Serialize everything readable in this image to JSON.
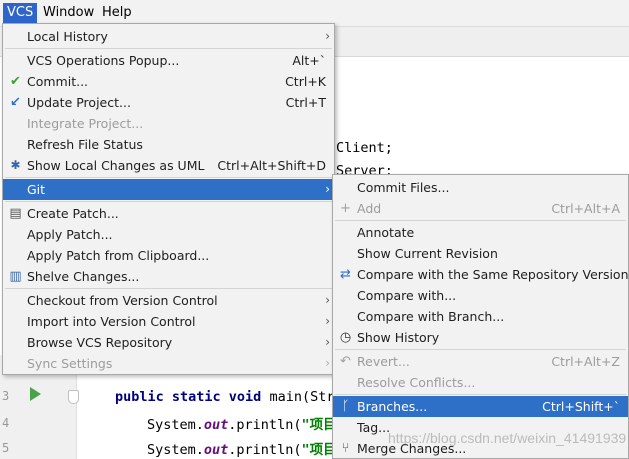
{
  "menubar": {
    "vcs": "VCS",
    "window": "Window",
    "help": "Help"
  },
  "editor": {
    "code_line_client": "Client;",
    "code_line_server": "Server;",
    "main_sig_kw": "public static void",
    "main_sig_rest": " main(Str",
    "println1_pre": "System.",
    "println1_out": "out",
    "println1_post": ".println(",
    "println1_str": "\"项目",
    "println2_pre": "System.",
    "println2_out": "out",
    "println2_post": ".println(",
    "println2_str": "\"项目",
    "line_numbers": [
      "3",
      "4",
      "5"
    ]
  },
  "vcs_menu": {
    "items": [
      {
        "label": "Local History",
        "shortcut": "",
        "submenu": true
      },
      {
        "label": "VCS Operations Popup...",
        "shortcut": "Alt+`"
      },
      {
        "label": "Commit...",
        "shortcut": "Ctrl+K",
        "icon": "check-icon"
      },
      {
        "label": "Update Project...",
        "shortcut": "Ctrl+T",
        "icon": "update-arrow-icon"
      },
      {
        "label": "Integrate Project...",
        "shortcut": "",
        "disabled": true
      },
      {
        "label": "Refresh File Status",
        "shortcut": ""
      },
      {
        "label": "Show Local Changes as UML",
        "shortcut": "Ctrl+Alt+Shift+D",
        "icon": "uml-icon"
      },
      {
        "label": "Git",
        "shortcut": "",
        "submenu": true,
        "selected": true
      },
      {
        "label": "Create Patch...",
        "shortcut": "",
        "icon": "patch-icon"
      },
      {
        "label": "Apply Patch...",
        "shortcut": ""
      },
      {
        "label": "Apply Patch from Clipboard...",
        "shortcut": ""
      },
      {
        "label": "Shelve Changes...",
        "shortcut": "",
        "icon": "shelve-icon"
      },
      {
        "label": "Checkout from Version Control",
        "shortcut": "",
        "submenu": true
      },
      {
        "label": "Import into Version Control",
        "shortcut": "",
        "submenu": true
      },
      {
        "label": "Browse VCS Repository",
        "shortcut": "",
        "submenu": true
      },
      {
        "label": "Sync Settings",
        "shortcut": "",
        "submenu": true,
        "disabled": true
      }
    ]
  },
  "git_menu": {
    "items": [
      {
        "label": "Commit Files...",
        "shortcut": ""
      },
      {
        "label": "Add",
        "shortcut": "Ctrl+Alt+A",
        "disabled": true,
        "icon": "plus-icon"
      },
      {
        "label": "Annotate",
        "shortcut": ""
      },
      {
        "label": "Show Current Revision",
        "shortcut": ""
      },
      {
        "label": "Compare with the Same Repository Version",
        "shortcut": "",
        "icon": "compare-icon"
      },
      {
        "label": "Compare with...",
        "shortcut": ""
      },
      {
        "label": "Compare with Branch...",
        "shortcut": ""
      },
      {
        "label": "Show History",
        "shortcut": "",
        "icon": "history-clock-icon"
      },
      {
        "label": "Revert...",
        "shortcut": "Ctrl+Alt+Z",
        "disabled": true,
        "icon": "revert-icon"
      },
      {
        "label": "Resolve Conflicts...",
        "shortcut": "",
        "disabled": true
      },
      {
        "label": "Branches...",
        "shortcut": "Ctrl+Shift+`",
        "selected": true,
        "icon": "branch-icon"
      },
      {
        "label": "Tag...",
        "shortcut": ""
      },
      {
        "label": "Merge Changes...",
        "shortcut": "",
        "icon": "merge-icon"
      }
    ]
  },
  "watermark": "https://blog.csdn.net/weixin_41491939",
  "colors": {
    "menu_bg": "#f2f2f2",
    "selection": "#2e70c8",
    "menubar_active": "#2f65ca"
  }
}
